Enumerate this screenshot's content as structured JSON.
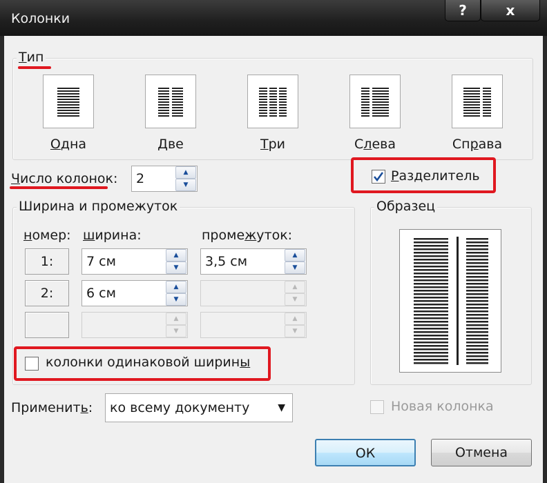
{
  "window": {
    "title": "Колонки",
    "help_label": "?",
    "close_label": "x"
  },
  "type_group": {
    "label_underlined": "Т",
    "label_rest": "ип",
    "presets": [
      {
        "id": "one",
        "u": "О",
        "rest": "дна",
        "columns": 1
      },
      {
        "id": "two",
        "u": "Д",
        "rest": "ве",
        "columns": 2
      },
      {
        "id": "three",
        "u": "Т",
        "rest": "ри",
        "columns": 3
      },
      {
        "id": "left",
        "pre": "С",
        "u": "л",
        "rest": "ева",
        "columns": 2
      },
      {
        "id": "right",
        "pre": "Сп",
        "u": "р",
        "rest": "ава",
        "columns": 2
      }
    ]
  },
  "num_columns": {
    "label_u": "Ч",
    "label_rest": "исло колонок",
    "colon": ":",
    "value": "2"
  },
  "separator": {
    "label_u": "Р",
    "label_rest": "азделитель",
    "checked": true
  },
  "width_spacing": {
    "label": "Ширина и промежуток",
    "col_number_u": "н",
    "col_number_rest": "омер:",
    "col_width_u": "ш",
    "col_width_rest": "ирина:",
    "col_spacing_pre": "проме",
    "col_spacing_u": "ж",
    "col_spacing_rest": "уток:",
    "rows": [
      {
        "num": "1:",
        "width": "7 см",
        "spacing": "3,5 см"
      },
      {
        "num": "2:",
        "width": "6 см",
        "spacing": ""
      },
      {
        "num": "",
        "width": "",
        "spacing": ""
      }
    ]
  },
  "equal_width": {
    "label_pre": "колонки одинаковой ширин",
    "label_u": "ы",
    "checked": false
  },
  "sample": {
    "label": "Образец"
  },
  "apply": {
    "label_pre": "Применит",
    "label_u": "ь",
    "colon": ":",
    "value": "ко всему документу"
  },
  "new_column": {
    "label": "Новая колонка",
    "checked": false,
    "disabled": true
  },
  "buttons": {
    "ok": "ОК",
    "cancel": "Отмена"
  },
  "colors": {
    "highlight": "#e01820",
    "check": "#1a4e9a"
  }
}
